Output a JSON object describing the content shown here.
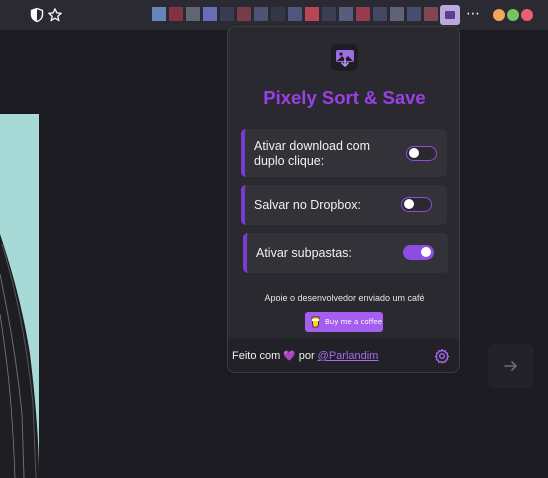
{
  "browser": {
    "tab_pixel_colors": [
      "#6d8fc9",
      "#c7394a",
      "#8f95a5",
      "#6f74c8",
      "#434a6e",
      "#b7485c",
      "#515877",
      "#3b4053",
      "#6a7ab8",
      "#c74a55",
      "#4b5070",
      "#7b86b8",
      "#a33e52",
      "#5a6088",
      "#8a8fb0",
      "#4a5377",
      "#c95c6b",
      "#6b708f"
    ],
    "window_dot_colors": [
      "#f3a55c",
      "#76c361",
      "#ec5f73"
    ],
    "icons": [
      "shield-icon",
      "star-icon",
      "extension-icon",
      "more-icon"
    ]
  },
  "popup": {
    "title": "Pixely Sort & Save",
    "logo_icon": "image-download-icon",
    "accent_color": "#9a40e6",
    "options": [
      {
        "label": "Ativar download com duplo clique:",
        "enabled": false
      },
      {
        "label": "Salvar no Dropbox:",
        "enabled": false
      },
      {
        "label": "Ativar subpastas:",
        "enabled": true
      }
    ],
    "support_text": "Apoie o desenvolvedor enviado um café",
    "coffee_button_label": "Buy me a coffee",
    "footer": {
      "made_with": "Feito com",
      "heart": "💜",
      "by": "por",
      "author_link": "@Parlandim",
      "settings_icon": "gear-icon"
    }
  },
  "page": {
    "next_arrow_icon": "arrow-right-icon"
  }
}
